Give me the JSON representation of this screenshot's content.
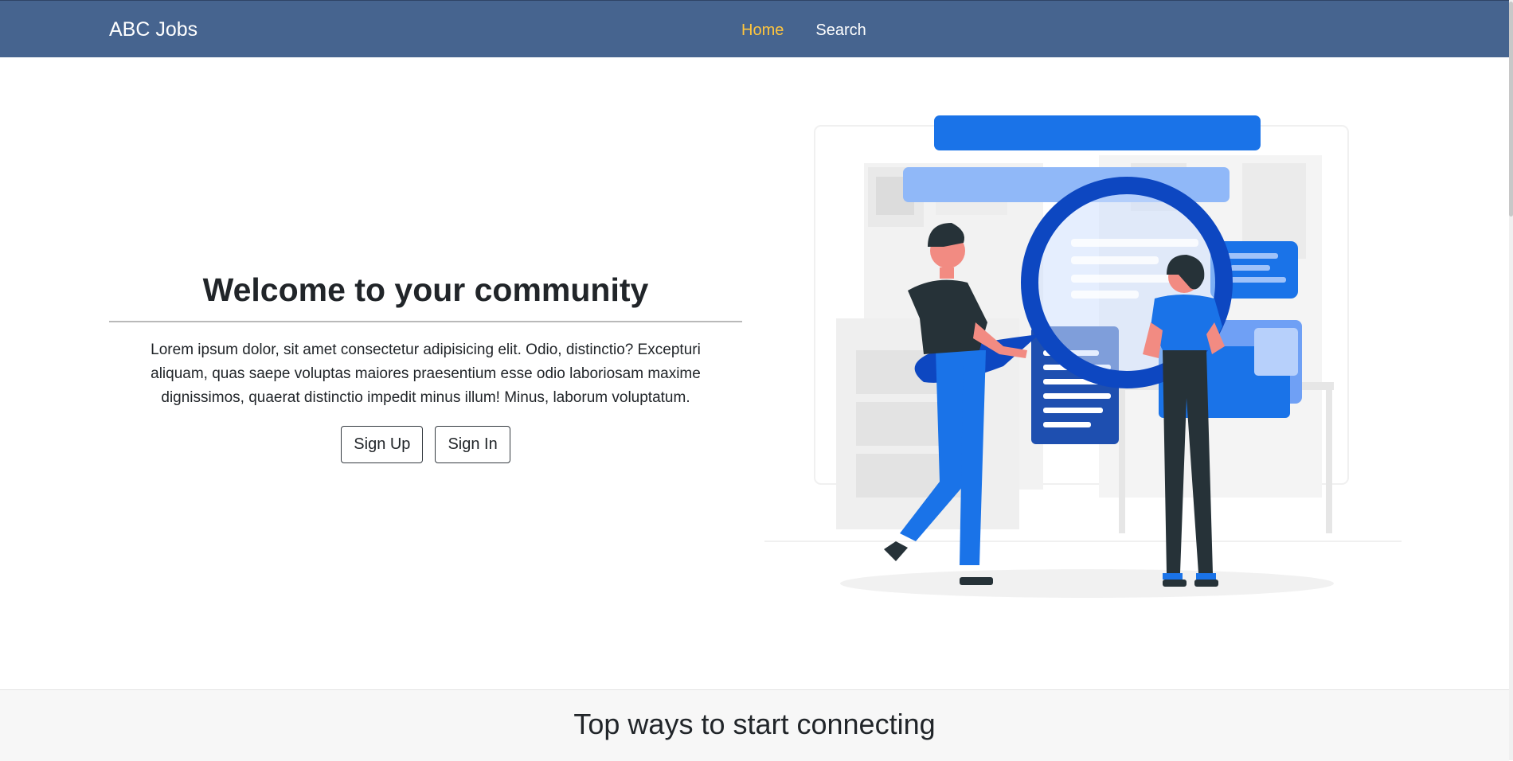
{
  "navbar": {
    "brand": "ABC Jobs",
    "links": [
      {
        "label": "Home",
        "active": true
      },
      {
        "label": "Search",
        "active": false
      }
    ],
    "background": "#46648f",
    "active_color": "#ffc53d"
  },
  "hero": {
    "title": "Welcome to your community",
    "description": "Lorem ipsum dolor, sit amet consectetur adipisicing elit. Odio, distinctio? Excepturi aliquam, quas saepe voluptas maiores praesentium esse odio laboriosam maxime dignissimos, quaerat distinctio impedit minus illum! Minus, laborum voluptatum.",
    "buttons": {
      "sign_up": "Sign Up",
      "sign_in": "Sign In"
    },
    "illustration": "people-searching-illustration"
  },
  "section": {
    "title": "Top ways to start connecting"
  },
  "colors": {
    "accent_blue": "#1a73e8",
    "dark_blue": "#0d47a1",
    "light_blue": "#90b8f8"
  }
}
